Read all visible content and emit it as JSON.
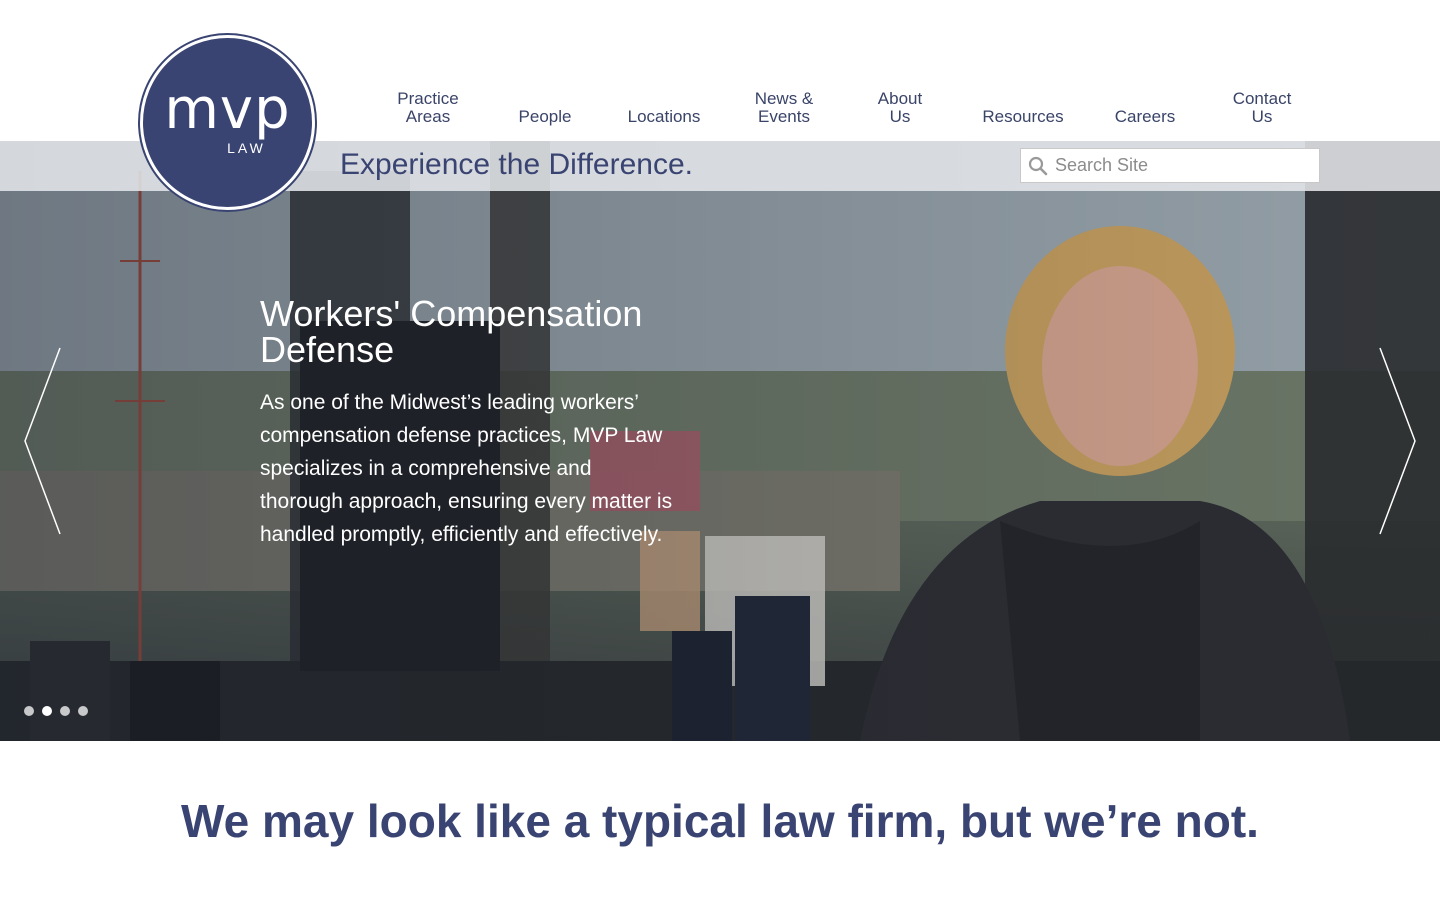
{
  "brand": {
    "logo_mark": "mvp",
    "logo_sub": "LAW",
    "color": "#3a4472"
  },
  "nav": {
    "items": [
      {
        "label": "Practice\nAreas"
      },
      {
        "label": "People"
      },
      {
        "label": "Locations"
      },
      {
        "label": "News &\nEvents"
      },
      {
        "label": "About\nUs"
      },
      {
        "label": "Resources"
      },
      {
        "label": "Careers"
      },
      {
        "label": "Contact\nUs"
      }
    ]
  },
  "tagline": "Experience the Difference.",
  "search": {
    "placeholder": "Search Site",
    "icon": "search-icon"
  },
  "hero": {
    "title": "Workers' Compensation Defense",
    "text": "As one of the Midwest’s leading workers’ compensation defense practices, MVP Law specializes in a comprehensive and thorough approach, ensuring every matter is handled promptly, efficiently and effectively.",
    "slide_count": 4,
    "active_slide": 2,
    "prev_icon": "chevron-left-icon",
    "next_icon": "chevron-right-icon"
  },
  "intro": {
    "heading": "We may look like a typical law firm, but we’re not."
  }
}
